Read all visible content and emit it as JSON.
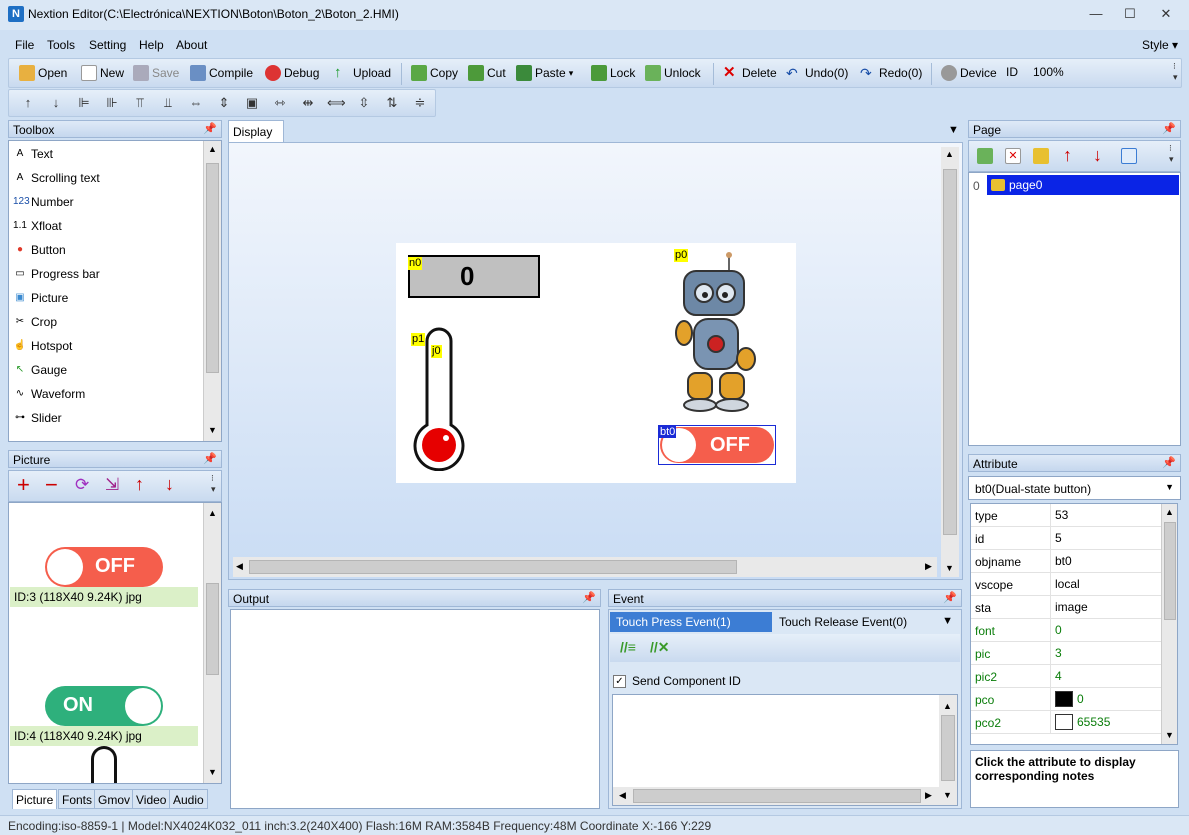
{
  "window": {
    "title": "Nextion Editor(C:\\Electrónica\\NEXTION\\Boton\\Boton_2\\Boton_2.HMI)",
    "app_icon": "nextion-logo-icon"
  },
  "menu": [
    "File",
    "Tools",
    "Setting",
    "Help",
    "About"
  ],
  "style_label": "Style",
  "toolbar": {
    "open": "Open",
    "new": "New",
    "save": "Save",
    "compile": "Compile",
    "debug": "Debug",
    "upload": "Upload",
    "copy": "Copy",
    "cut": "Cut",
    "paste": "Paste",
    "lock": "Lock",
    "unlock": "Unlock",
    "delete": "Delete",
    "undo": "Undo(0)",
    "redo": "Redo(0)",
    "device": "Device",
    "id": "ID",
    "zoom": "100%"
  },
  "toolbox": {
    "title": "Toolbox",
    "items": [
      {
        "label": "Text",
        "icon": "text-icon"
      },
      {
        "label": "Scrolling text",
        "icon": "scrolling-text-icon"
      },
      {
        "label": "Number",
        "icon": "number-icon"
      },
      {
        "label": "Xfloat",
        "icon": "xfloat-icon"
      },
      {
        "label": "Button",
        "icon": "button-icon"
      },
      {
        "label": "Progress bar",
        "icon": "progress-bar-icon"
      },
      {
        "label": "Picture",
        "icon": "picture-icon"
      },
      {
        "label": "Crop",
        "icon": "crop-icon"
      },
      {
        "label": "Hotspot",
        "icon": "hotspot-icon"
      },
      {
        "label": "Gauge",
        "icon": "gauge-icon"
      },
      {
        "label": "Waveform",
        "icon": "waveform-icon"
      },
      {
        "label": "Slider",
        "icon": "slider-icon"
      }
    ]
  },
  "picture_panel": {
    "title": "Picture",
    "items": [
      {
        "caption": "ID:3  (118X40 9.24K) jpg",
        "text": "OFF"
      },
      {
        "caption": "ID:4  (118X40 9.24K) jpg",
        "text": "ON"
      }
    ],
    "tabs": [
      "Picture",
      "Fonts",
      "Gmov",
      "Video",
      "Audio"
    ]
  },
  "display": {
    "tab": "Display",
    "n0_tag": "n0",
    "n0_value": "0",
    "p0_tag": "p0",
    "p1_tag": "p1",
    "j0_tag": "j0",
    "bt0_tag": "bt0",
    "bt0_text": "OFF"
  },
  "output": {
    "title": "Output"
  },
  "event": {
    "title": "Event",
    "tab_press": "Touch Press Event(1)",
    "tab_release": "Touch Release Event(0)",
    "send_id_label": "Send Component ID",
    "send_id_checked": true
  },
  "page_panel": {
    "title": "Page",
    "index": "0",
    "page_name": "page0"
  },
  "attribute": {
    "title": "Attribute",
    "selected": "bt0(Dual-state button)",
    "rows": [
      {
        "k": "type",
        "v": "53",
        "green": false
      },
      {
        "k": "id",
        "v": "5",
        "green": false
      },
      {
        "k": "objname",
        "v": "bt0",
        "green": false
      },
      {
        "k": "vscope",
        "v": "local",
        "green": false
      },
      {
        "k": "sta",
        "v": "image",
        "green": false
      },
      {
        "k": "font",
        "v": "0",
        "green": true
      },
      {
        "k": "pic",
        "v": "3",
        "green": true
      },
      {
        "k": "pic2",
        "v": "4",
        "green": true
      },
      {
        "k": "pco",
        "v": "0",
        "green": true,
        "swatch": "#000000"
      },
      {
        "k": "pco2",
        "v": "65535",
        "green": true,
        "swatch": "#ffffff"
      }
    ],
    "note": "Click the attribute to display corresponding notes"
  },
  "status": {
    "text": "Encoding:iso-8859-1 | Model:NX4024K032_011 inch:3.2(240X400) Flash:16M RAM:3584B Frequency:48M    Coordinate X:-166  Y:229"
  }
}
